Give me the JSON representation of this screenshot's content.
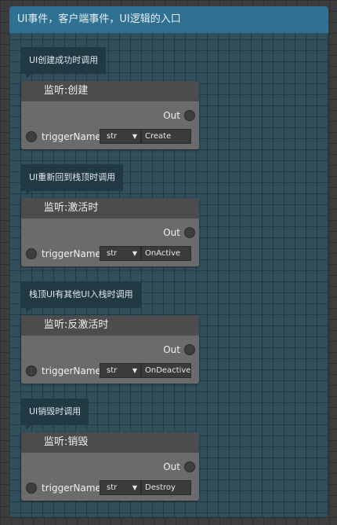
{
  "group": {
    "title": "UI事件，客户端事件，UI逻辑的入口"
  },
  "blocks": [
    {
      "comment": "UI创建成功时调用",
      "node_title": "监听:创建",
      "out_label": "Out",
      "param_label": "triggerName",
      "param_type": "str",
      "param_value": "Create"
    },
    {
      "comment": "UI重新回到栈顶时调用",
      "node_title": "监听:激活时",
      "out_label": "Out",
      "param_label": "triggerName",
      "param_type": "str",
      "param_value": "OnActive"
    },
    {
      "comment": "栈顶UI有其他UI入栈时调用",
      "node_title": "监听:反激活时",
      "out_label": "Out",
      "param_label": "triggerName",
      "param_type": "str",
      "param_value": "OnDeactive"
    },
    {
      "comment": "UI销毁时调用",
      "node_title": "监听:销毁",
      "out_label": "Out",
      "param_label": "triggerName",
      "param_type": "str",
      "param_value": "Destroy"
    }
  ],
  "icons": {
    "dropdown": "chevron-down-icon",
    "pin": "pin-circle-icon"
  },
  "colors": {
    "group_header": "#2e7193",
    "group_body": "#324f5c",
    "node_body": "#6b6b6b",
    "node_title": "#4c4c4c",
    "comment": "#213943"
  }
}
